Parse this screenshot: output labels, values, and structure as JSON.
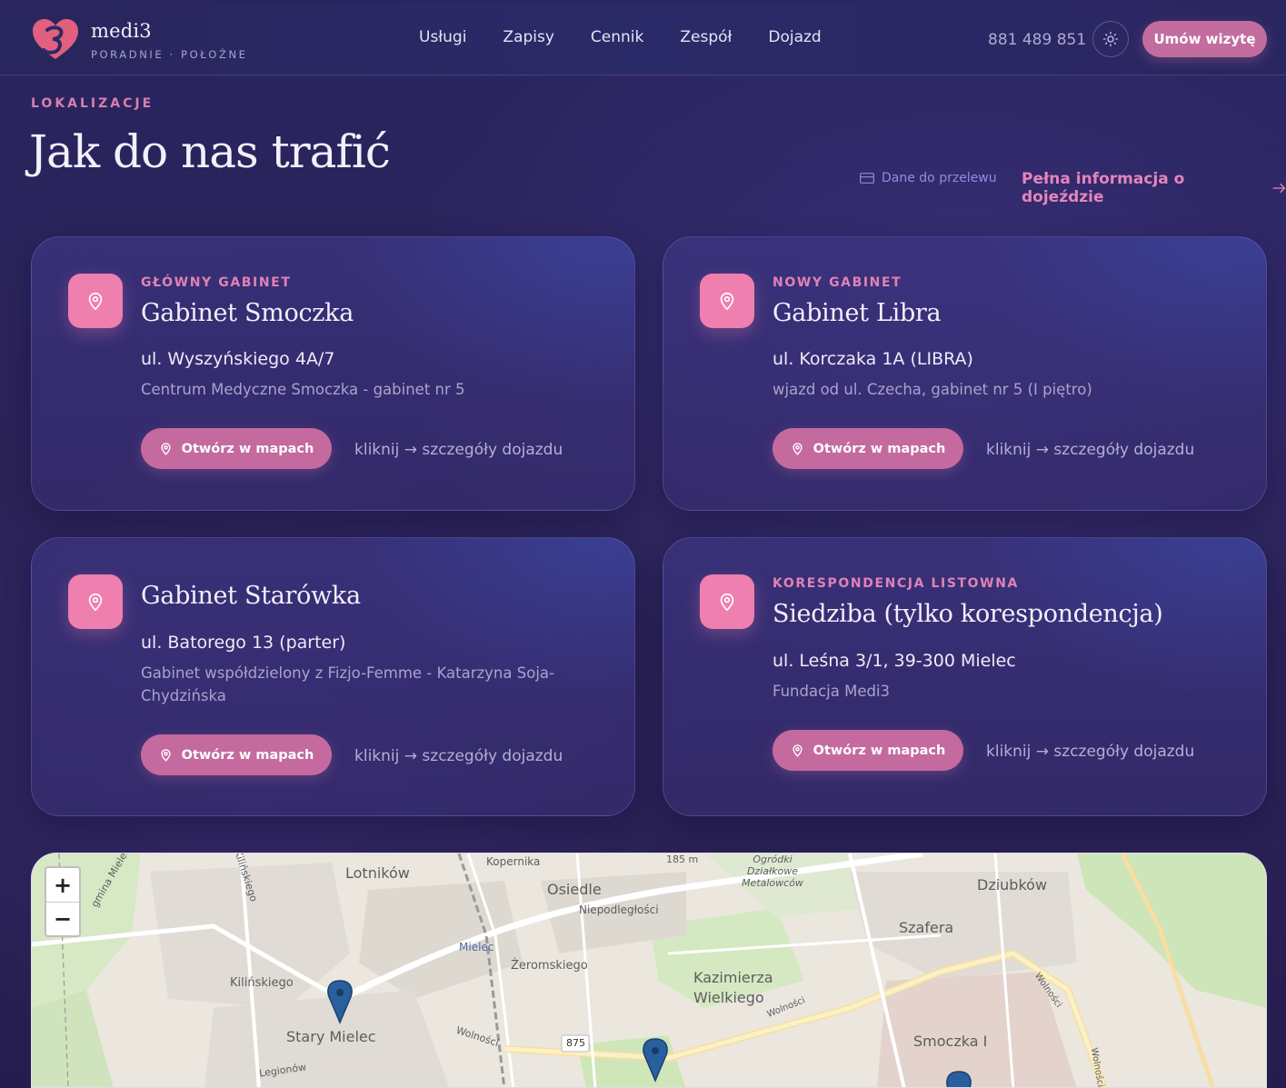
{
  "brand": {
    "name": "medi3",
    "subtitle": "PORADNIE · POŁOŻNE"
  },
  "nav": [
    "Usługi",
    "Zapisy",
    "Cennik",
    "Zespół",
    "Dojazd"
  ],
  "header": {
    "phone": "881 489 851",
    "theme_icon": "sun-icon",
    "cta": "Umów wizytę"
  },
  "section": {
    "eyebrow": "LOKALIZACJE",
    "title": "Jak do nas trafić",
    "transfer_link": "Dane do przelewu",
    "full_info_link": "Pełna informacja o dojeździe"
  },
  "locations": [
    {
      "tag": "GŁÓWNY GABINET",
      "title": "Gabinet Smoczka",
      "address": "ul. Wyszyńskiego 4A/7",
      "note": "Centrum Medyczne Smoczka - gabinet nr 5",
      "button": "Otwórz w mapach",
      "details": "kliknij → szczegóły dojazdu"
    },
    {
      "tag": "NOWY GABINET",
      "title": "Gabinet Libra",
      "address": "ul. Korczaka 1A (LIBRA)",
      "note": "wjazd od ul. Czecha, gabinet nr 5 (I piętro)",
      "button": "Otwórz w mapach",
      "details": "kliknij → szczegóły dojazdu"
    },
    {
      "tag": "",
      "title": "Gabinet Starówka",
      "address": "ul. Batorego 13 (parter)",
      "note": "Gabinet współdzielony z Fizjo-Femme - Katarzyna Soja-Chydzińska",
      "button": "Otwórz w mapach",
      "details": "kliknij → szczegóły dojazdu"
    },
    {
      "tag": "KORESPONDENCJA LISTOWNA",
      "title": "Siedziba (tylko korespondencja)",
      "address": "ul. Leśna 3/1, 39-300 Mielec",
      "note": "Fundacja Medi3",
      "button": "Otwórz w mapach",
      "details": "kliknij → szczegóły dojazdu"
    }
  ],
  "map": {
    "zoom_in": "+",
    "zoom_out": "−",
    "labels": [
      "Kopernika",
      "Lotników",
      "Osiedle",
      "Niepodległości",
      "Dziubków",
      "Szafera",
      "Mielec",
      "Żeromskiego",
      "Kilińskiego",
      "Kazimierza Wielkiego",
      "Stary Mielec",
      "Wolności",
      "875",
      "Smoczka I",
      "Legionów",
      "Kilińskiego",
      "185 m",
      "Ogródki Działkowe Metalowców",
      "gmina Mielec",
      "Wolności",
      "Wolności",
      "Wolności"
    ]
  }
}
